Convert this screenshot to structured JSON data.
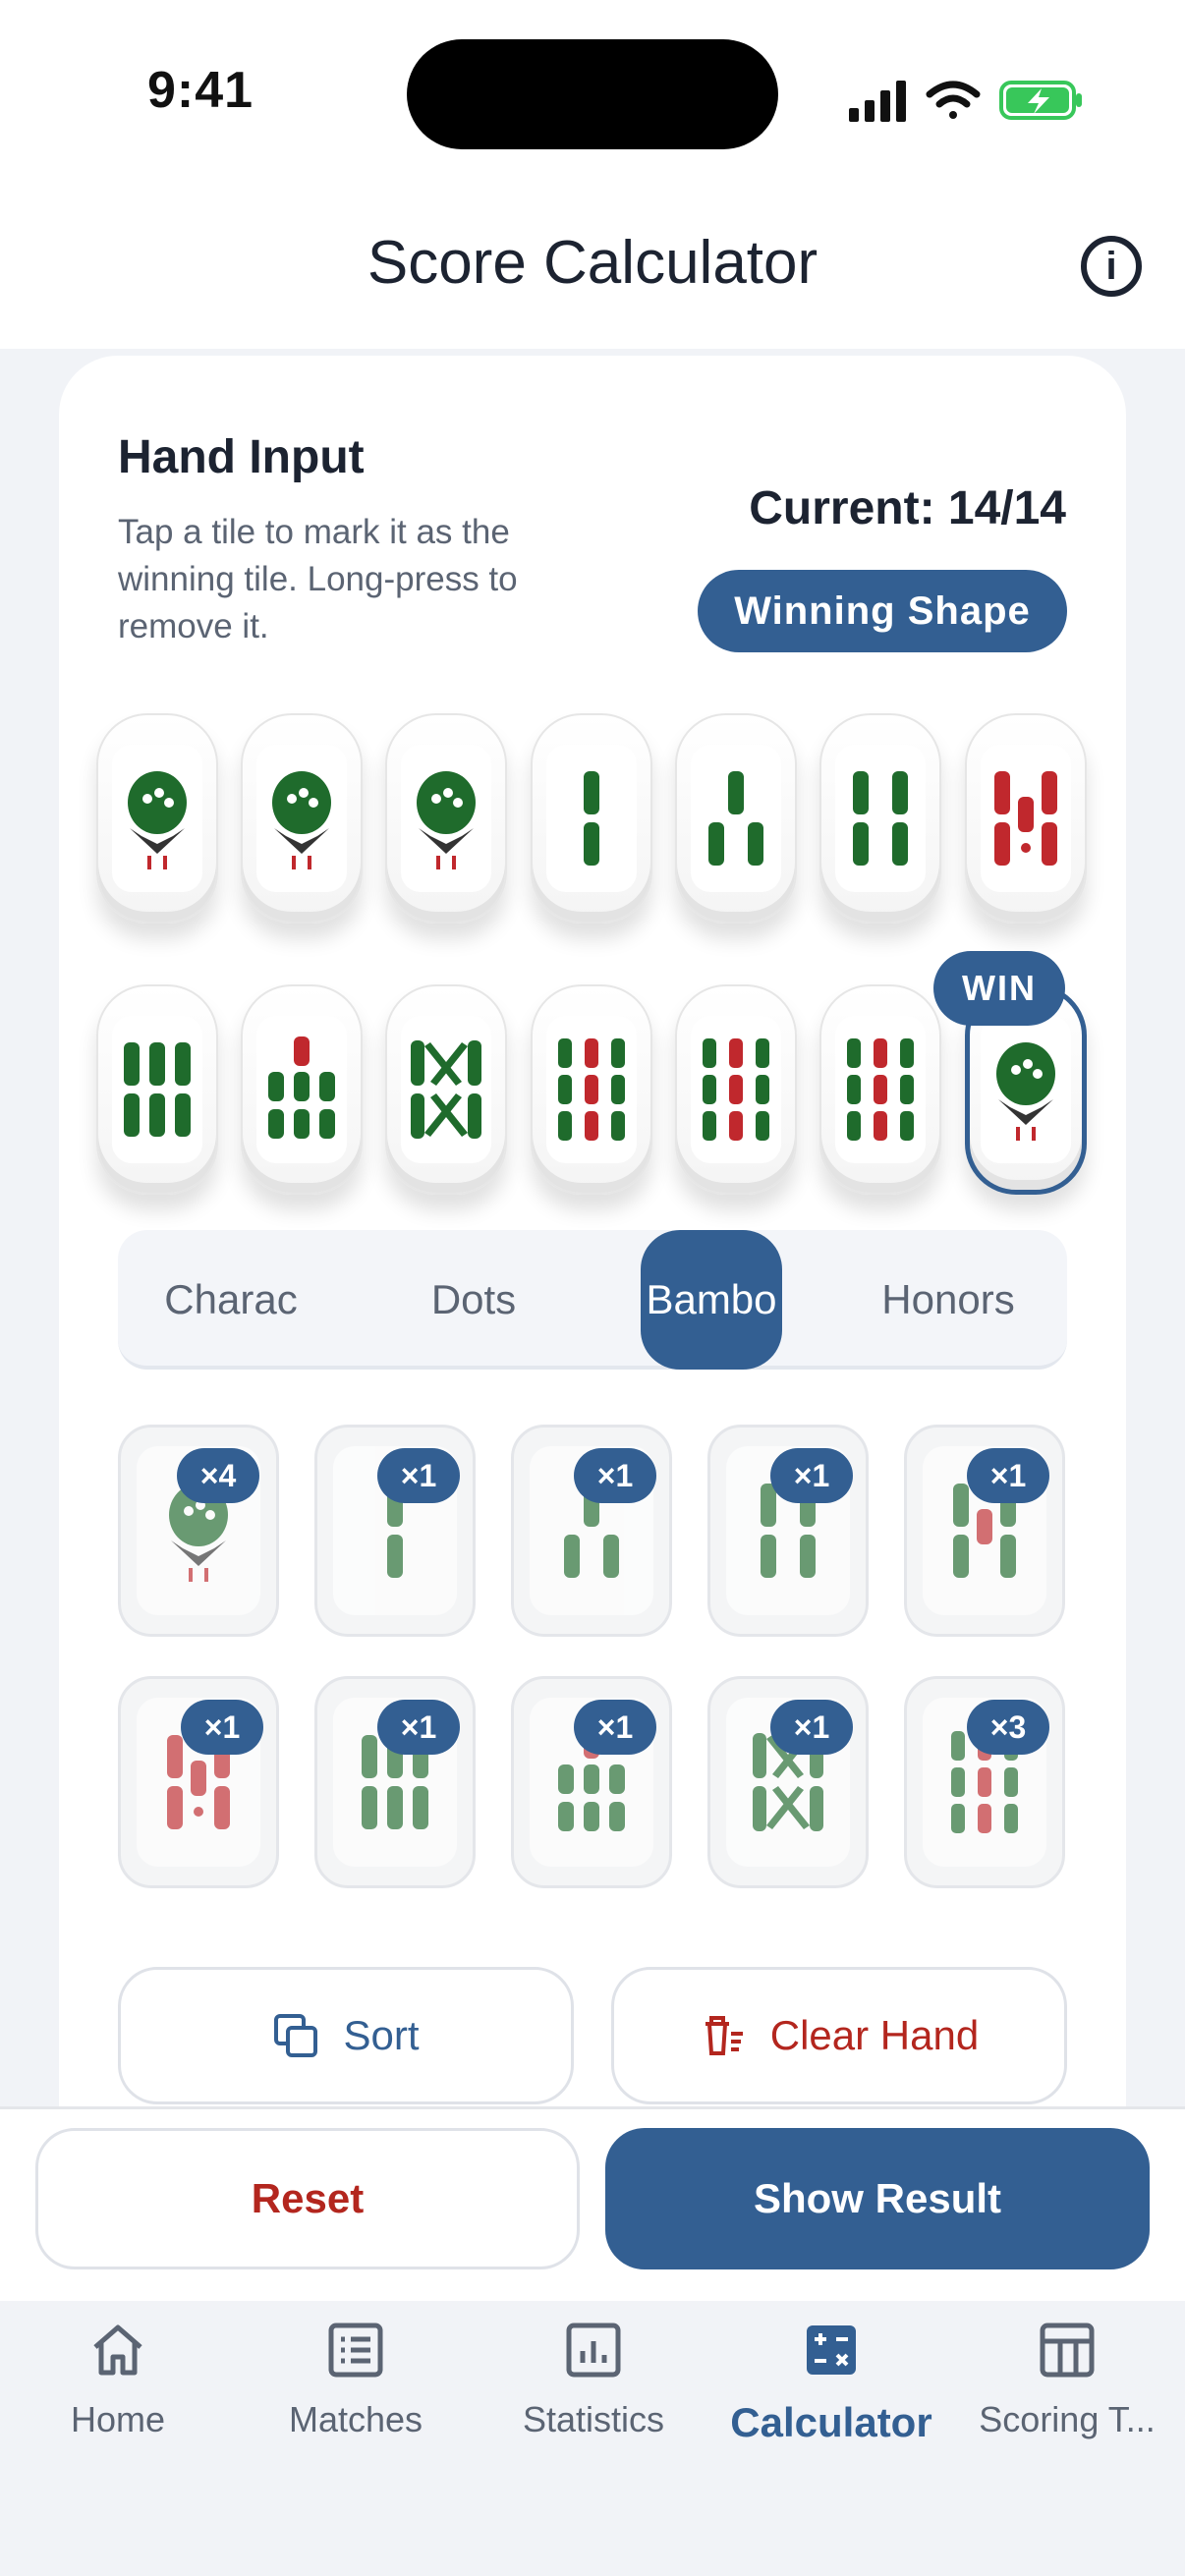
{
  "status": {
    "time": "9:41"
  },
  "header": {
    "title": "Score Calculator",
    "info_icon": "info-icon"
  },
  "hand": {
    "title": "Hand Input",
    "desc": "Tap a tile to mark it as the winning tile. Long-press to remove it.",
    "count": "Current: 14/14",
    "shape_button": "Winning Shape",
    "win_badge": "WIN",
    "tiles": [
      "1-bamboo",
      "1-bamboo",
      "1-bamboo",
      "2-bamboo",
      "3-bamboo",
      "4-bamboo",
      "5-bamboo",
      "6-bamboo",
      "7-bamboo",
      "8-bamboo",
      "9-bamboo",
      "9-bamboo",
      "9-bamboo",
      "1-bamboo"
    ]
  },
  "tabs": [
    {
      "label": "Charac"
    },
    {
      "label": "Dots"
    },
    {
      "label": "Bambo"
    },
    {
      "label": "Honors"
    }
  ],
  "palette": [
    {
      "tile": "1-bamboo",
      "count": "×4"
    },
    {
      "tile": "2-bamboo",
      "count": "×1"
    },
    {
      "tile": "3-bamboo",
      "count": "×1"
    },
    {
      "tile": "4-bamboo",
      "count": "×1"
    },
    {
      "tile": "5-bamboo",
      "count": "×1"
    },
    {
      "tile": "6-bamboo",
      "count": "×1"
    },
    {
      "tile": "7-bamboo",
      "count": "×1"
    },
    {
      "tile": "8-bamboo",
      "count": "×1"
    },
    {
      "tile": "9-bamboo",
      "count": "×1"
    },
    {
      "tile": "9-bamboo",
      "count": "×3"
    }
  ],
  "actions": {
    "sort": "Sort",
    "clear": "Clear Hand"
  },
  "footer": {
    "reset": "Reset",
    "show_result": "Show Result"
  },
  "nav": [
    {
      "label": "Home"
    },
    {
      "label": "Matches"
    },
    {
      "label": "Statistics"
    },
    {
      "label": "Calculator"
    },
    {
      "label": "Scoring T..."
    }
  ],
  "colors": {
    "accent": "#335f92",
    "danger": "#b3261e",
    "bamboo_green": "#1f6b2c",
    "bamboo_red": "#c0282d"
  }
}
